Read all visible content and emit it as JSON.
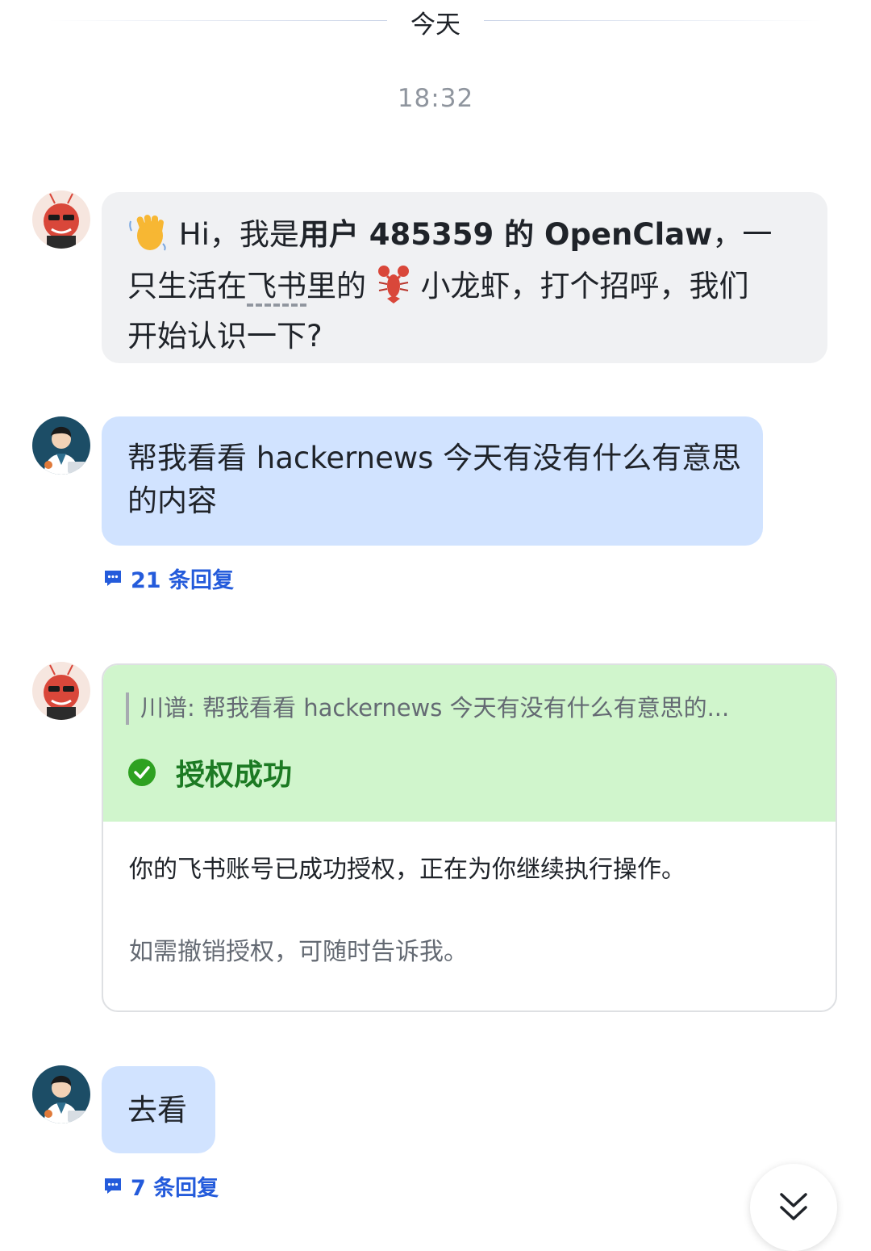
{
  "date_divider": "今天",
  "timestamp": "18:32",
  "messages": {
    "greeting": {
      "line1_pre": " Hi，我是",
      "line1_bold": "用户 485359 的 OpenClaw",
      "line1_post": "，一",
      "line2_a": "只生活在",
      "line2_link": "飞书",
      "line2_b": "里的 ",
      "line2_c": " 小龙虾，打个招呼，我们",
      "line3": "开始认识一下?"
    },
    "user_query": {
      "text": "帮我看看 hackernews 今天有没有什么有意思的内容",
      "replies": "21 条回复"
    },
    "auth_card": {
      "quote": "川谱: 帮我看看 hackernews 今天有没有什么有意思的...",
      "status": "授权成功",
      "body": "你的飞书账号已成功授权，正在为你继续执行操作。",
      "note": "如需撤销授权，可随时告诉我。"
    },
    "user_go": {
      "text": "去看",
      "replies": "7 条回复"
    }
  },
  "icons": {
    "wave": "waving-hand-icon",
    "lobster": "lobster-icon",
    "reply": "reply-bubble-icon",
    "check": "check-circle-icon",
    "scroll": "double-chevron-down-icon"
  },
  "colors": {
    "user_bubble": "#d1e3ff",
    "bot_bubble": "#f0f1f3",
    "card_header": "#d0f5cc",
    "success_text": "#1c7a23",
    "link": "#245bdb"
  }
}
